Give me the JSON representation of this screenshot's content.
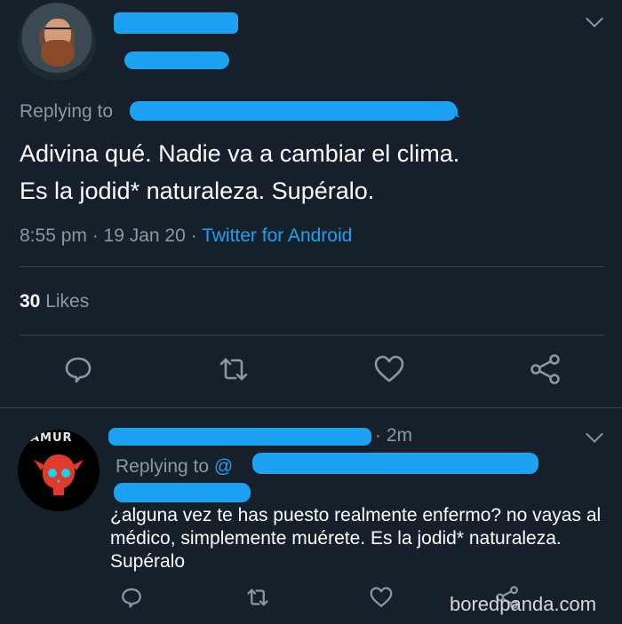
{
  "main_tweet": {
    "replying_label": "Replying to",
    "replying_tail": "a",
    "text_line1": "Adivina qué. Nadie va a cambiar el clima.",
    "text_line2": "Es la jodid* naturaleza. Supéralo.",
    "time": "8:55 pm · 19 Jan 20 · ",
    "source": "Twitter for Android",
    "likes_count": "30",
    "likes_label": " Likes",
    "actions": [
      "reply-icon",
      "retweet-icon",
      "like-icon",
      "share-icon"
    ]
  },
  "reply_tweet": {
    "avatar_banner": "AMUR",
    "time": "· 2m",
    "replying_label": "Replying to ",
    "replying_at": "@",
    "text": "¿alguna vez te has puesto realmente enfermo? no vayas al médico, simplemente muérete. Es la jodid* naturaleza. Supéralo",
    "actions": [
      "reply-icon",
      "retweet-icon",
      "like-icon",
      "share-icon"
    ]
  },
  "watermark": "boredpanda.com",
  "colors": {
    "background": "#15202b",
    "accent": "#1da1f2",
    "muted": "#8899a6",
    "divider": "#38444d"
  }
}
